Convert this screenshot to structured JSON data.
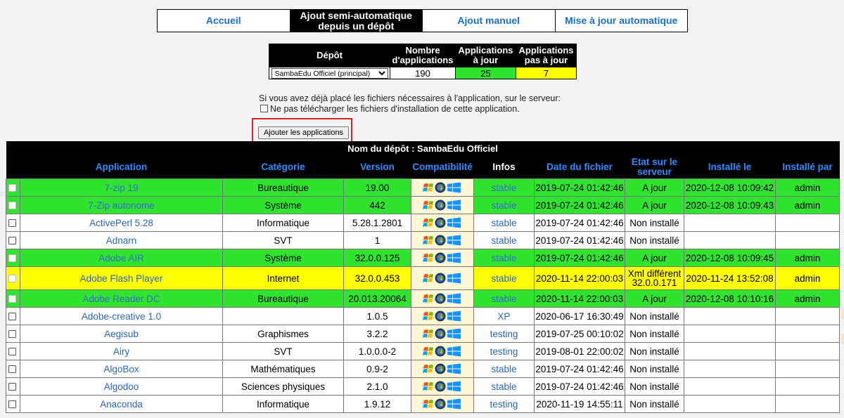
{
  "nav": {
    "tabs": [
      {
        "label": "Accueil",
        "active": false
      },
      {
        "label": "Ajout semi-automatique depuis un dépôt",
        "active": true
      },
      {
        "label": "Ajout manuel",
        "active": false
      },
      {
        "label": "Mise à jour automatique",
        "active": false
      }
    ]
  },
  "depot_table": {
    "headers": [
      "Dépôt",
      "Nombre d'applications",
      "Applications à jour",
      "Applications pas à jour"
    ],
    "selected_depot": "SambaEdu Officiel (principal)",
    "count": "190",
    "up_to_date": "25",
    "not_up_to_date": "7"
  },
  "note": {
    "text": "Si vous avez déjà placé les fichiers nécessaires à l'application, sur le serveur:",
    "checkbox_label": "Ne pas télécharger les fichiers d'installation de cette application."
  },
  "add_button_label": "Ajouter les applications",
  "apps_table": {
    "title": "Nom du dépôt : SambaEdu Officiel",
    "columns": [
      "Application",
      "Catégorie",
      "Version",
      "Compatibilité",
      "Infos",
      "Date du fichier",
      "Etat sur le serveur",
      "Installé le",
      "Installé par"
    ],
    "rows": [
      {
        "name": "7-zip 19",
        "category": "Bureautique",
        "version": "19.00",
        "infos": "stable",
        "date": "2019-07-24 01:42:46",
        "state": "A jour",
        "installed": "2020-12-08 10:09:42",
        "by": "admin",
        "status": "g"
      },
      {
        "name": "7-Zip autonome",
        "category": "Système",
        "version": "442",
        "infos": "stable",
        "date": "2019-07-24 01:42:46",
        "state": "A jour",
        "installed": "2020-12-08 10:09:43",
        "by": "admin",
        "status": "g"
      },
      {
        "name": "ActivePerl 5.28",
        "category": "Informatique",
        "version": "5.28.1.2801",
        "infos": "stable",
        "date": "2019-07-24 01:42:46",
        "state": "Non installé",
        "installed": "",
        "by": "",
        "status": "w"
      },
      {
        "name": "Adnarn",
        "category": "SVT",
        "version": "1",
        "infos": "stable",
        "date": "2019-07-24 01:42:46",
        "state": "Non installé",
        "installed": "",
        "by": "",
        "status": "w"
      },
      {
        "name": "Adobe AIR",
        "category": "Système",
        "version": "32.0.0.125",
        "infos": "stable",
        "date": "2019-07-24 01:42:46",
        "state": "A jour",
        "installed": "2020-12-08 10:09:45",
        "by": "admin",
        "status": "g"
      },
      {
        "name": "Adobe Flash Player",
        "category": "Internet",
        "version": "32.0.0.453",
        "infos": "stable",
        "date": "2020-11-14 22:00:03",
        "state": "Xml différent 32.0.0.171",
        "installed": "2020-11-24 13:52:08",
        "by": "admin",
        "status": "y"
      },
      {
        "name": "Adobe Reader DC",
        "category": "Bureautique",
        "version": "20.013.20064",
        "infos": "stable",
        "date": "2020-11-14 22:00:03",
        "state": "A jour",
        "installed": "2020-12-08 10:10:16",
        "by": "admin",
        "status": "g"
      },
      {
        "name": "Adobe-creative 1.0",
        "category": "",
        "version": "1.0.5",
        "infos": "XP",
        "date": "2020-06-17 16:30:49",
        "state": "Non installé",
        "installed": "",
        "by": "",
        "status": "w"
      },
      {
        "name": "Aegisub",
        "category": "Graphismes",
        "version": "3.2.2",
        "infos": "testing",
        "date": "2019-07-25 00:10:02",
        "state": "Non installé",
        "installed": "",
        "by": "",
        "status": "w"
      },
      {
        "name": "Airy",
        "category": "SVT",
        "version": "1.0.0.0-2",
        "infos": "testing",
        "date": "2019-08-01 22:00:02",
        "state": "Non installé",
        "installed": "",
        "by": "",
        "status": "w"
      },
      {
        "name": "AlgoBox",
        "category": "Mathématiques",
        "version": "0.9-2",
        "infos": "stable",
        "date": "2019-07-24 01:42:46",
        "state": "Non installé",
        "installed": "",
        "by": "",
        "status": "w"
      },
      {
        "name": "Algodoo",
        "category": "Sciences physiques",
        "version": "2.1.0",
        "infos": "stable",
        "date": "2019-07-24 01:42:46",
        "state": "Non installé",
        "installed": "",
        "by": "",
        "status": "w"
      },
      {
        "name": "Anaconda",
        "category": "Informatique",
        "version": "1.9.12",
        "infos": "testing",
        "date": "2020-11-19 14:55:11",
        "state": "Non installé",
        "installed": "",
        "by": "",
        "status": "w"
      }
    ]
  },
  "colors": {
    "up_to_date": "#2fe32f",
    "different": "#ffff00",
    "link_blue": "#2f8cff",
    "highlight_red": "#d62525"
  },
  "icons": [
    "xp-flag-icon",
    "vista-orb-icon",
    "windows10-logo-icon"
  ]
}
